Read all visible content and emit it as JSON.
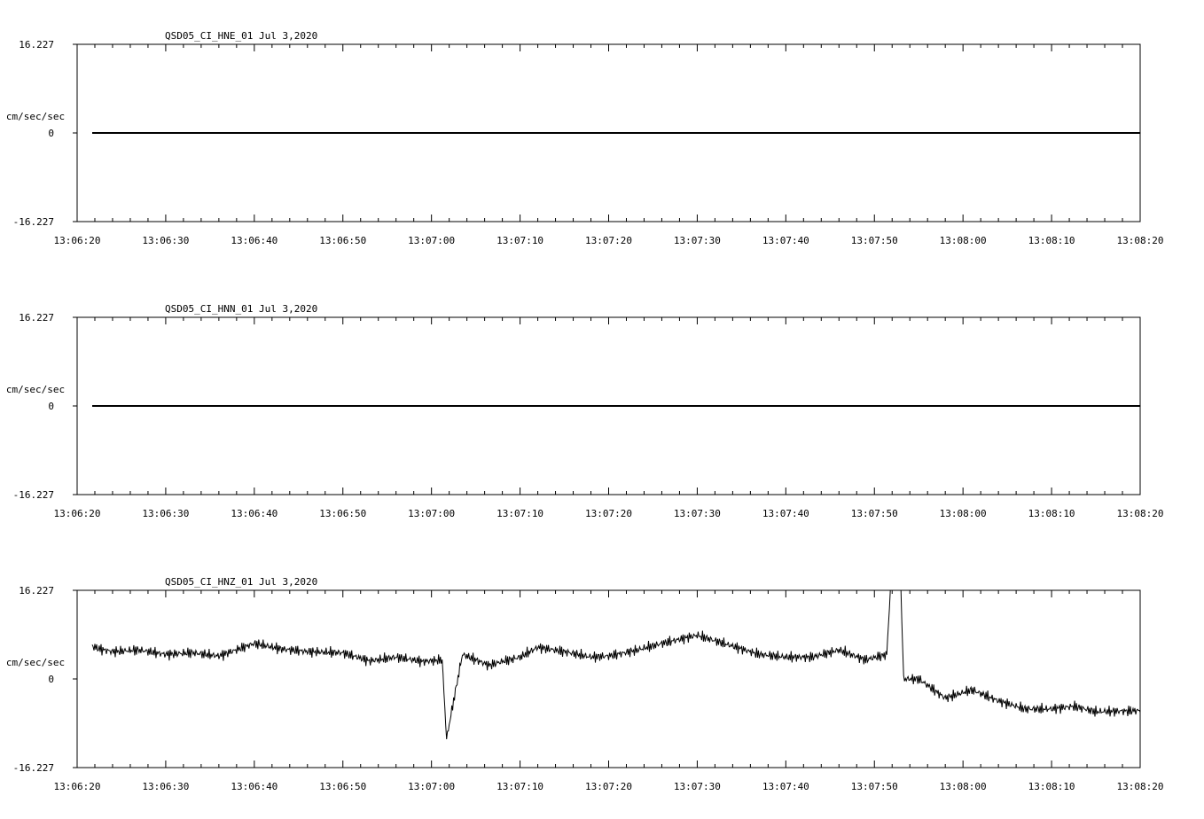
{
  "chart_data": [
    {
      "type": "line",
      "title": "QSD05_CI_HNE_01  Jul 3,2020",
      "ylabel": "cm/sec/sec",
      "ytick_labels": [
        "16.227",
        "0",
        "-16.227"
      ],
      "ylim": [
        -16.227,
        16.227
      ],
      "xtick_labels": [
        "13:06:20",
        "13:06:30",
        "13:06:40",
        "13:06:50",
        "13:07:00",
        "13:07:10",
        "13:07:20",
        "13:07:30",
        "13:07:40",
        "13:07:50",
        "13:08:00",
        "13:08:10",
        "13:08:20"
      ],
      "xlim": [
        "13:06:20",
        "13:08:20"
      ],
      "grid": false,
      "series": [
        {
          "x": [
            "13:06:21.7",
            "13:08:20"
          ],
          "y": [
            0,
            0
          ]
        }
      ]
    },
    {
      "type": "line",
      "title": "QSD05_CI_HNN_01  Jul 3,2020",
      "ylabel": "cm/sec/sec",
      "ytick_labels": [
        "16.227",
        "0",
        "-16.227"
      ],
      "ylim": [
        -16.227,
        16.227
      ],
      "xtick_labels": [
        "13:06:20",
        "13:06:30",
        "13:06:40",
        "13:06:50",
        "13:07:00",
        "13:07:10",
        "13:07:20",
        "13:07:30",
        "13:07:40",
        "13:07:50",
        "13:08:00",
        "13:08:10",
        "13:08:20"
      ],
      "xlim": [
        "13:06:20",
        "13:08:20"
      ],
      "grid": false,
      "series": [
        {
          "x": [
            "13:06:21.7",
            "13:08:20"
          ],
          "y": [
            0,
            0
          ]
        }
      ]
    },
    {
      "type": "line",
      "title": "QSD05_CI_HNZ_01  Jul 3,2020",
      "ylabel": "cm/sec/sec",
      "ytick_labels": [
        "16.227",
        "0",
        "-16.227"
      ],
      "ylim": [
        -16.227,
        16.227
      ],
      "xtick_labels": [
        "13:06:20",
        "13:06:30",
        "13:06:40",
        "13:06:50",
        "13:07:00",
        "13:07:10",
        "13:07:20",
        "13:07:30",
        "13:07:40",
        "13:07:50",
        "13:08:00",
        "13:08:10",
        "13:08:20"
      ],
      "xlim": [
        "13:06:20",
        "13:08:20"
      ],
      "grid": false,
      "series": [
        {
          "x": [
            "13:06:21.7",
            "13:06:22.5",
            "13:06:24",
            "13:06:27",
            "13:06:30",
            "13:06:33",
            "13:06:36",
            "13:06:40",
            "13:06:43",
            "13:06:46",
            "13:06:50",
            "13:06:53",
            "13:06:56",
            "13:06:59",
            "13:07:01.2",
            "13:07:01.7",
            "13:07:02.5",
            "13:07:03.5",
            "13:07:05",
            "13:07:06.5",
            "13:07:08",
            "13:07:10",
            "13:07:12",
            "13:07:15",
            "13:07:18",
            "13:07:20",
            "13:07:23",
            "13:07:26",
            "13:07:30",
            "13:07:33",
            "13:07:37",
            "13:07:40",
            "13:07:43",
            "13:07:46",
            "13:07:49",
            "13:07:51.4",
            "13:07:51.8",
            "13:07:53",
            "13:07:53.3",
            "13:07:55",
            "13:07:58",
            "13:08:01",
            "13:08:04",
            "13:08:07",
            "13:08:10",
            "13:08:12.5",
            "13:08:15",
            "13:08:20"
          ],
          "y": [
            6,
            5.5,
            5,
            5.3,
            4.5,
            4.8,
            4.2,
            6.5,
            5.5,
            5,
            4.8,
            3.3,
            4,
            3.2,
            3.5,
            -11,
            -4,
            4.5,
            3.5,
            2.5,
            3.2,
            4,
            5.8,
            5,
            4,
            4.2,
            5.2,
            6.5,
            8,
            6.5,
            4.5,
            4,
            4,
            5.3,
            3.5,
            4.5,
            16.227,
            16.227,
            0,
            0,
            -3.5,
            -2,
            -4,
            -5.5,
            -5.5,
            -5,
            -6,
            -5.8
          ]
        }
      ]
    }
  ]
}
